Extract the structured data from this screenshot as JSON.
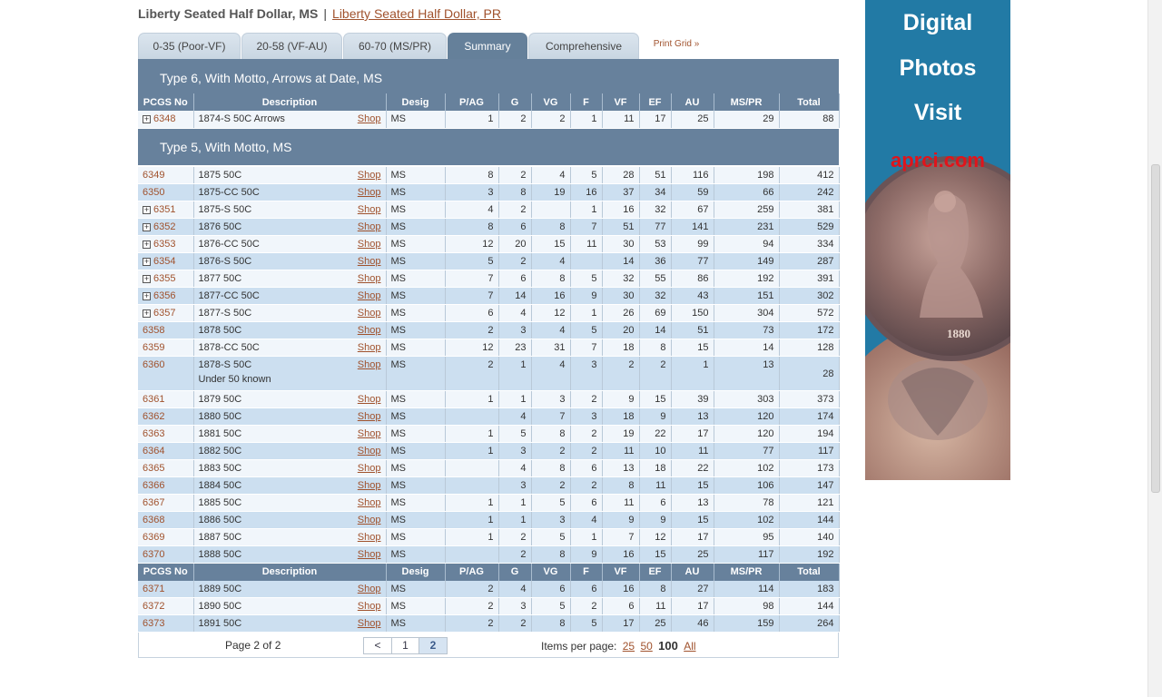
{
  "header": {
    "title": "Liberty Seated Half Dollar, MS",
    "separator": "|",
    "link": "Liberty Seated Half Dollar, PR"
  },
  "tabs": [
    "0-35 (Poor-VF)",
    "20-58 (VF-AU)",
    "60-70 (MS/PR)",
    "Summary",
    "Comprehensive",
    "Print Grid »"
  ],
  "active_tab": "Summary",
  "columns": [
    "PCGS No",
    "Description",
    "Desig",
    "P/AG",
    "G",
    "VG",
    "F",
    "VF",
    "EF",
    "AU",
    "MS/PR",
    "Total"
  ],
  "shop_label": "Shop",
  "section1": {
    "title": "Type 6, With Motto, Arrows at Date, MS",
    "rows": [
      {
        "no": "6348",
        "plus": true,
        "desc": "1874-S 50C Arrows",
        "desig": "MS",
        "v": [
          "1",
          "2",
          "2",
          "1",
          "11",
          "17",
          "25",
          "29",
          "88"
        ]
      }
    ]
  },
  "section2": {
    "title": "Type 5, With Motto, MS",
    "rows": [
      {
        "no": "6349",
        "plus": false,
        "desc": "1875 50C",
        "desig": "MS",
        "v": [
          "8",
          "2",
          "4",
          "5",
          "28",
          "51",
          "116",
          "198",
          "412"
        ]
      },
      {
        "no": "6350",
        "plus": false,
        "desc": "1875-CC 50C",
        "desig": "MS",
        "v": [
          "3",
          "8",
          "19",
          "16",
          "37",
          "34",
          "59",
          "66",
          "242"
        ]
      },
      {
        "no": "6351",
        "plus": true,
        "desc": "1875-S 50C",
        "desig": "MS",
        "v": [
          "4",
          "2",
          "",
          "1",
          "16",
          "32",
          "67",
          "259",
          "381"
        ]
      },
      {
        "no": "6352",
        "plus": true,
        "desc": "1876 50C",
        "desig": "MS",
        "v": [
          "8",
          "6",
          "8",
          "7",
          "51",
          "77",
          "141",
          "231",
          "529"
        ]
      },
      {
        "no": "6353",
        "plus": true,
        "desc": "1876-CC 50C",
        "desig": "MS",
        "v": [
          "12",
          "20",
          "15",
          "11",
          "30",
          "53",
          "99",
          "94",
          "334"
        ]
      },
      {
        "no": "6354",
        "plus": true,
        "desc": "1876-S 50C",
        "desig": "MS",
        "v": [
          "5",
          "2",
          "4",
          "",
          "14",
          "36",
          "77",
          "149",
          "287"
        ]
      },
      {
        "no": "6355",
        "plus": true,
        "desc": "1877 50C",
        "desig": "MS",
        "v": [
          "7",
          "6",
          "8",
          "5",
          "32",
          "55",
          "86",
          "192",
          "391"
        ]
      },
      {
        "no": "6356",
        "plus": true,
        "desc": "1877-CC 50C",
        "desig": "MS",
        "v": [
          "7",
          "14",
          "16",
          "9",
          "30",
          "32",
          "43",
          "151",
          "302"
        ]
      },
      {
        "no": "6357",
        "plus": true,
        "desc": "1877-S 50C",
        "desig": "MS",
        "v": [
          "6",
          "4",
          "12",
          "1",
          "26",
          "69",
          "150",
          "304",
          "572"
        ]
      },
      {
        "no": "6358",
        "plus": false,
        "desc": "1878 50C",
        "desig": "MS",
        "v": [
          "2",
          "3",
          "4",
          "5",
          "20",
          "14",
          "51",
          "73",
          "172"
        ]
      },
      {
        "no": "6359",
        "plus": false,
        "desc": "1878-CC 50C",
        "desig": "MS",
        "v": [
          "12",
          "23",
          "31",
          "7",
          "18",
          "8",
          "15",
          "14",
          "128"
        ]
      },
      {
        "no": "6360",
        "plus": false,
        "desc": "1878-S 50C",
        "note": "Under 50 known",
        "desig": "MS",
        "v": [
          "2",
          "1",
          "4",
          "3",
          "2",
          "2",
          "1",
          "13",
          "28"
        ]
      },
      {
        "no": "6361",
        "plus": false,
        "desc": "1879 50C",
        "desig": "MS",
        "v": [
          "1",
          "1",
          "3",
          "2",
          "9",
          "15",
          "39",
          "303",
          "373"
        ]
      },
      {
        "no": "6362",
        "plus": false,
        "desc": "1880 50C",
        "desig": "MS",
        "v": [
          "",
          "4",
          "7",
          "3",
          "18",
          "9",
          "13",
          "120",
          "174"
        ]
      },
      {
        "no": "6363",
        "plus": false,
        "desc": "1881 50C",
        "desig": "MS",
        "v": [
          "1",
          "5",
          "8",
          "2",
          "19",
          "22",
          "17",
          "120",
          "194"
        ]
      },
      {
        "no": "6364",
        "plus": false,
        "desc": "1882 50C",
        "desig": "MS",
        "v": [
          "1",
          "3",
          "2",
          "2",
          "11",
          "10",
          "11",
          "77",
          "117"
        ]
      },
      {
        "no": "6365",
        "plus": false,
        "desc": "1883 50C",
        "desig": "MS",
        "v": [
          "",
          "4",
          "8",
          "6",
          "13",
          "18",
          "22",
          "102",
          "173"
        ]
      },
      {
        "no": "6366",
        "plus": false,
        "desc": "1884 50C",
        "desig": "MS",
        "v": [
          "",
          "3",
          "2",
          "2",
          "8",
          "11",
          "15",
          "106",
          "147"
        ]
      },
      {
        "no": "6367",
        "plus": false,
        "desc": "1885 50C",
        "desig": "MS",
        "v": [
          "1",
          "1",
          "5",
          "6",
          "11",
          "6",
          "13",
          "78",
          "121"
        ]
      },
      {
        "no": "6368",
        "plus": false,
        "desc": "1886 50C",
        "desig": "MS",
        "v": [
          "1",
          "1",
          "3",
          "4",
          "9",
          "9",
          "15",
          "102",
          "144"
        ]
      },
      {
        "no": "6369",
        "plus": false,
        "desc": "1887 50C",
        "desig": "MS",
        "v": [
          "1",
          "2",
          "5",
          "1",
          "7",
          "12",
          "17",
          "95",
          "140"
        ]
      },
      {
        "no": "6370",
        "plus": false,
        "desc": "1888 50C",
        "desig": "MS",
        "v": [
          "",
          "2",
          "8",
          "9",
          "16",
          "15",
          "25",
          "117",
          "192"
        ]
      }
    ],
    "rows_after_header": [
      {
        "no": "6371",
        "plus": false,
        "desc": "1889 50C",
        "desig": "MS",
        "v": [
          "2",
          "4",
          "6",
          "6",
          "16",
          "8",
          "27",
          "114",
          "183"
        ]
      },
      {
        "no": "6372",
        "plus": false,
        "desc": "1890 50C",
        "desig": "MS",
        "v": [
          "2",
          "3",
          "5",
          "2",
          "6",
          "11",
          "17",
          "98",
          "144"
        ]
      },
      {
        "no": "6373",
        "plus": false,
        "desc": "1891 50C",
        "desig": "MS",
        "v": [
          "2",
          "2",
          "8",
          "5",
          "17",
          "25",
          "46",
          "159",
          "264"
        ]
      }
    ]
  },
  "pager": {
    "status": "Page 2 of 2",
    "prev": "<",
    "pages": [
      "1",
      "2"
    ],
    "current": "2",
    "items_label": "Items per page:",
    "options": [
      "25",
      "50",
      "100",
      "All"
    ],
    "selected": "100"
  },
  "ad": {
    "lines": [
      "Digital",
      "Photos",
      "Visit"
    ],
    "url": "aprci.com",
    "coin_year": "1880",
    "bg": "#227aa5"
  }
}
